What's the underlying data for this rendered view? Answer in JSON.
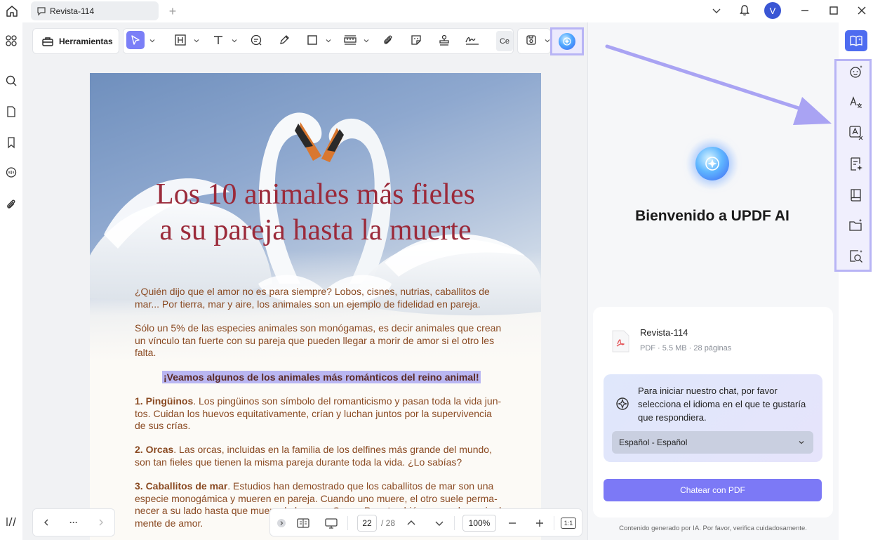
{
  "tab": {
    "title": "Revista-114"
  },
  "toolbar": {
    "tools_label": "Herramientas",
    "partial_label": "Ce"
  },
  "document": {
    "title_line1": "Los 10 animales más fieles",
    "title_line2": "a su pareja hasta la muerte",
    "p1_l1": "¿Quién dijo que el amor no es para siempre? Lobos, cisnes, nutrias, caballitos de",
    "p1_l2": "mar... Por tierra, mar y aire, los animales son un ejemplo de fidelidad en pareja.",
    "p2_l1": "Sólo un 5% de las especies animales son monógamas, es decir animales que crean",
    "p2_l2": "un vínculo tan fuerte con su pareja que pueden llegar a morir de amor si el otro les",
    "p2_l3": "falta.",
    "highlight": "¡Veamos algunos de los animales más románticos del reino animal!",
    "s1_head": "1. Pingüinos",
    "s1_l1": ". Los pingüinos son símbolo del romanticismo y pasan toda la vida jun-",
    "s1_l2": "tos. Cuidan los huevos equitativamente, crían y luchan juntos por la supervivencia",
    "s1_l3": "de sus crías.",
    "s2_head": "2. Orcas",
    "s2_l1": ". Las orcas, incluidas en la familia de los delfines más grande del mundo,",
    "s2_l2": "son tan fieles que tienen la misma pareja durante toda la vida. ¿Lo sabías?",
    "s3_head": "3. Caballitos de mar",
    "s3_l1": ". Estudios han demostrado que los caballitos de mar son una",
    "s3_l2": "especie monogámica y mueren en pareja. Cuando uno muere, el otro suele perma-",
    "s3_l3": "necer a su lado hasta que muera de la pena. Como. Pero también se puede morir el",
    "s3_l4": "mente de amor."
  },
  "pagebar": {
    "current_page": "22",
    "total_pages": "/ 28",
    "zoom": "100%",
    "fit_label": "1:1",
    "nav_more": "···"
  },
  "ai_panel": {
    "welcome": "Bienvenido a UPDF AI",
    "file_name": "Revista-114",
    "file_meta": "PDF · 5.5 MB · 28 páginas",
    "chat_prompt": "Para iniciar nuestro chat, por favor selecciona el idioma en el que te gustaría que respondiera.",
    "language": "Español - Español",
    "chat_button": "Chatear con PDF",
    "disclaimer": "Contenido generado por IA. Por favor, verifica cuidadosamente."
  },
  "user": {
    "initial": "V"
  },
  "colors": {
    "accent": "#7b7ff7",
    "highlight_frame": "#b8b4f5",
    "title_red": "#9b2a3a",
    "body_brown": "#8a4a22",
    "ai_blue": "#4e6cf0"
  }
}
